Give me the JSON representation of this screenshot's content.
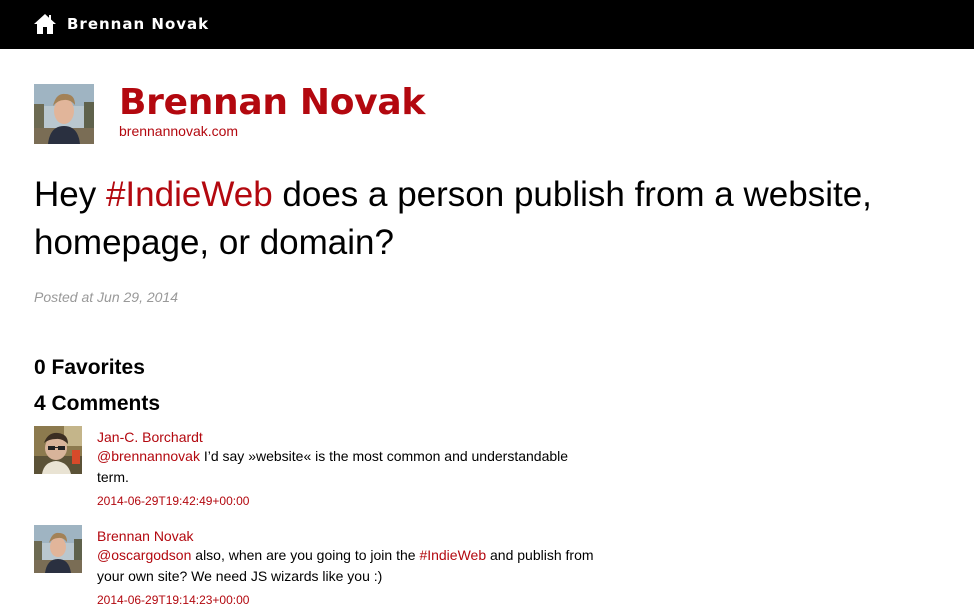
{
  "header": {
    "home_icon": "home-icon",
    "site_name": "Brennan Novak"
  },
  "author": {
    "name": "Brennan Novak",
    "url": "brennannovak.com"
  },
  "post": {
    "text_before": "Hey ",
    "hashtag": "#IndieWeb",
    "text_after": " does a person publish from a website, homepage, or domain?",
    "posted": "Posted at Jun 29, 2014"
  },
  "favorites_heading": "0 Favorites",
  "comments_heading": "4 Comments",
  "comments": [
    {
      "author": "Jan-C. Borchardt",
      "mention": "@brennannovak",
      "text_parts": [
        " I’d say »website« is the most common and understandable term."
      ],
      "timestamp": "2014-06-29T19:42:49+00:00"
    },
    {
      "author": "Brennan Novak",
      "mention": "@oscargodson",
      "text_before_tag": " also, when are you going to join the ",
      "hashtag": "#IndieWeb",
      "text_after_tag": " and publish from your own site? We need JS wizards like you :)",
      "timestamp": "2014-06-29T19:14:23+00:00"
    }
  ],
  "colors": {
    "accent": "#b3080f",
    "topbar": "#000000",
    "muted": "#999999"
  }
}
